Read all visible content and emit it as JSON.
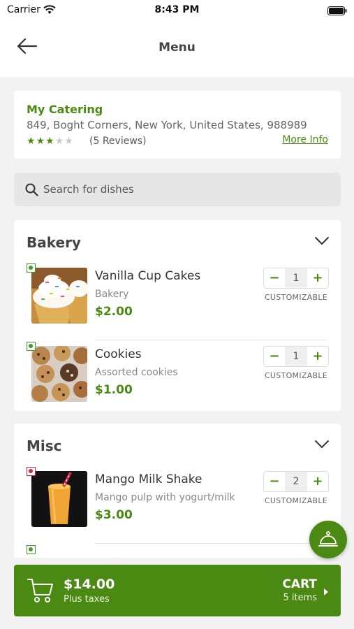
{
  "status_bar": {
    "carrier": "Carrier",
    "time": "8:43 PM"
  },
  "nav": {
    "title": "Menu"
  },
  "restaurant": {
    "name": "My Catering",
    "address": "849, Boght Corners, New York, United States, 988989",
    "rating": 3,
    "max_rating": 5,
    "reviews": "(5 Reviews)",
    "more_info": "More Info"
  },
  "search": {
    "placeholder": "Search for dishes"
  },
  "sections": [
    {
      "title": "Bakery",
      "dishes": [
        {
          "name": "Vanilla Cup Cakes",
          "description": "Bakery",
          "price": "$2.00",
          "quantity": "1",
          "type": "veg",
          "customizable": "CUSTOMIZABLE"
        },
        {
          "name": "Cookies",
          "description": "Assorted cookies",
          "price": "$1.00",
          "quantity": "1",
          "type": "veg",
          "customizable": "CUSTOMIZABLE"
        }
      ]
    },
    {
      "title": "Misc",
      "dishes": [
        {
          "name": "Mango Milk Shake",
          "description": "Mango pulp with yogurt/milk",
          "price": "$3.00",
          "quantity": "2",
          "type": "non-veg",
          "customizable": "CUSTOMIZABLE"
        }
      ]
    }
  ],
  "stepper": {
    "minus": "−",
    "plus": "+"
  },
  "cart": {
    "total": "$14.00",
    "taxes": "Plus taxes",
    "label": "CART",
    "items": "5 items"
  },
  "colors": {
    "brand_green": "#4a8a12",
    "veg": "#3f9e2a",
    "non_veg": "#d0283b"
  },
  "icons": {
    "back": "back-arrow-icon",
    "search": "search-icon",
    "chevron": "chevron-down-icon",
    "cart": "cart-icon",
    "floating": "cloche-icon"
  }
}
